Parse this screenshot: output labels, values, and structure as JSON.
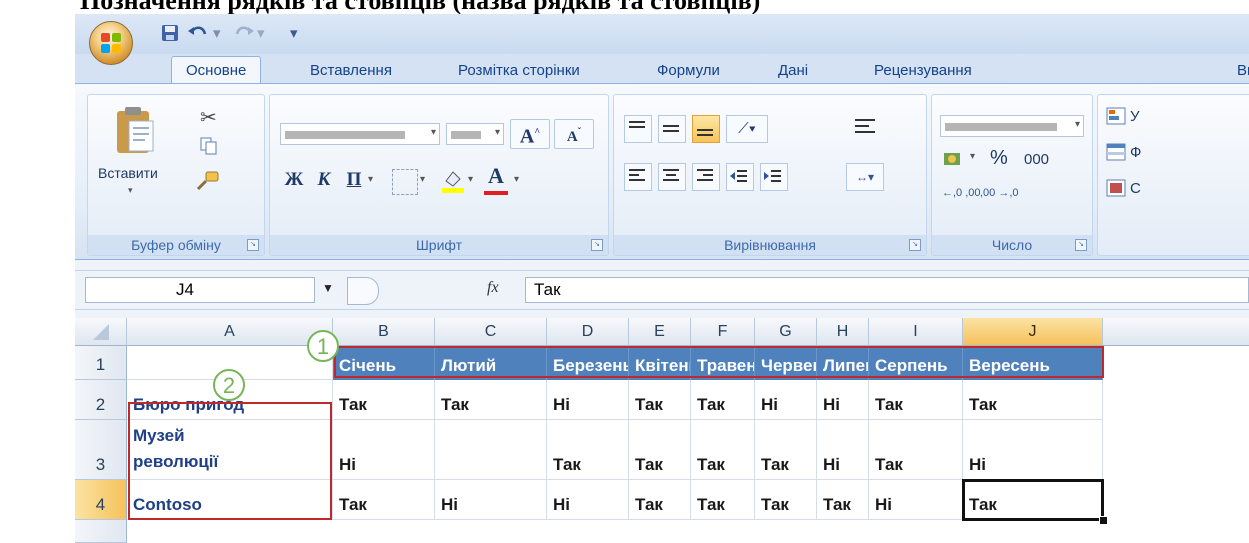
{
  "document": {
    "heading": "Позначення рядків та стовпців (назва рядків та стовпців)"
  },
  "colors": {
    "header_fill": "#4f81bd",
    "callout_red": "#c0292b",
    "callout_green": "#76b657",
    "selected_header": "#f5c15b"
  },
  "titlebar": {
    "save_icon": "save-icon",
    "undo_icon": "undo-icon",
    "redo_icon": "redo-icon",
    "qat_more": "▾"
  },
  "tabs": [
    "Основне",
    "Вставлення",
    "Розмітка сторінки",
    "Формули",
    "Дані",
    "Рецензування",
    "Ви"
  ],
  "ribbon": {
    "clipboard": {
      "label": "Буфер обміну",
      "paste": "Вставити"
    },
    "font": {
      "label": "Шрифт",
      "bold": "Ж",
      "italic": "К",
      "underline": "П",
      "grow": "A",
      "shrink": "A",
      "font_color": "A"
    },
    "alignment": {
      "label": "Вирівнювання"
    },
    "number": {
      "label": "Число",
      "percent": "%",
      "thousands": "000",
      "inc_decimal": "←,0 ,00",
      "dec_decimal": ",00 →,0"
    },
    "styles": {
      "item1": "У",
      "item2": "Ф",
      "item3": "С"
    }
  },
  "formula_bar": {
    "name_box": "J4",
    "fx": "fx",
    "value": "Так"
  },
  "sheet": {
    "columns": [
      "A",
      "B",
      "C",
      "D",
      "E",
      "F",
      "G",
      "H",
      "I",
      "J"
    ],
    "rows": [
      "1",
      "2",
      "3",
      "4"
    ],
    "header_row": [
      "Січень",
      "Лютий",
      "Березень",
      "Квітень",
      "Травень",
      "Червень",
      "Липень",
      "Серпень",
      "Вересень"
    ],
    "data": [
      {
        "label": [
          "Бюро пригод"
        ],
        "values": [
          "Так",
          "Так",
          "Ні",
          "Так",
          "Так",
          "Ні",
          "Ні",
          "Так",
          "Так"
        ]
      },
      {
        "label": [
          "Музей",
          "революції"
        ],
        "values": [
          "Ні",
          "",
          "Так",
          "Так",
          "Так",
          "Так",
          "Ні",
          "Так",
          "Ні"
        ]
      },
      {
        "label": [
          "Contoso"
        ],
        "values": [
          "Так",
          "Ні",
          "Ні",
          "Так",
          "Так",
          "Так",
          "Так",
          "Ні",
          "Так"
        ]
      }
    ],
    "active_cell": "J4"
  },
  "callouts": [
    "1",
    "2"
  ]
}
